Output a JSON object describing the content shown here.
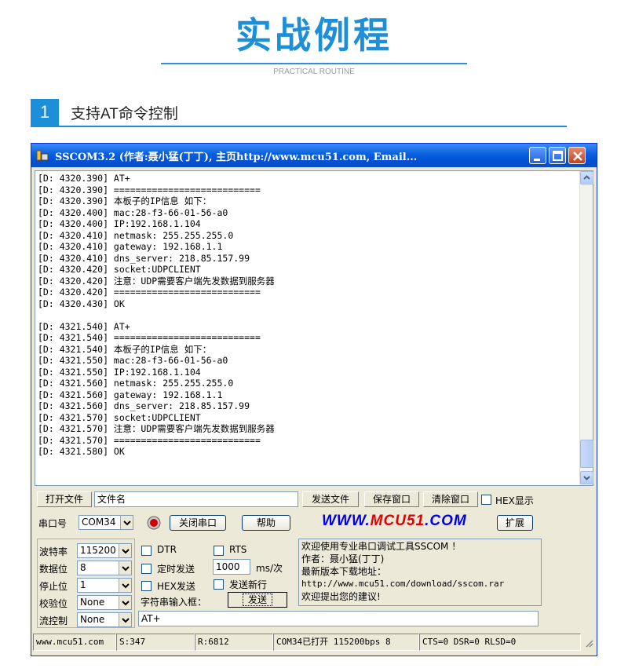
{
  "banner": {
    "title": "实战例程",
    "subtitle": "PRACTICAL ROUTINE",
    "section_number": "1",
    "section_title": "支持AT命令控制"
  },
  "window": {
    "title": "SSCOM3.2 (作者:聂小猛(丁丁), 主页http://www.mcu51.com,   Email...",
    "buttons": [
      "minimize",
      "maximize",
      "close"
    ]
  },
  "console_lines": [
    "[D: 4320.390] AT+",
    "[D: 4320.390] ===========================",
    "[D: 4320.390] 本板子的IP信息 如下：",
    "[D: 4320.400] mac:28-f3-66-01-56-a0",
    "[D: 4320.400] IP:192.168.1.104",
    "[D: 4320.410] netmask: 255.255.255.0",
    "[D: 4320.410] gateway: 192.168.1.1",
    "[D: 4320.410] dns_server: 218.85.157.99",
    "[D: 4320.420] socket:UDPCLIENT",
    "[D: 4320.420] 注意：UDP需要客户端先发数据到服务器",
    "[D: 4320.420] ===========================",
    "[D: 4320.430] OK",
    "",
    "[D: 4321.540] AT+",
    "[D: 4321.540] ===========================",
    "[D: 4321.540] 本板子的IP信息 如下：",
    "[D: 4321.550] mac:28-f3-66-01-56-a0",
    "[D: 4321.550] IP:192.168.1.104",
    "[D: 4321.560] netmask: 255.255.255.0",
    "[D: 4321.560] gateway: 192.168.1.1",
    "[D: 4321.560] dns_server: 218.85.157.99",
    "[D: 4321.570] socket:UDPCLIENT",
    "[D: 4321.570] 注意：UDP需要客户端先发数据到服务器",
    "[D: 4321.570] ===========================",
    "[D: 4321.580] OK"
  ],
  "toolbar": {
    "open_file": "打开文件",
    "file_name": "文件名",
    "send_file": "发送文件",
    "save_window": "保存窗口",
    "clear_window": "清除窗口",
    "hex_display": "HEX显示"
  },
  "port_row": {
    "port_label": "串口号",
    "port_value": "COM34",
    "close_port": "关闭串口",
    "help": "帮助",
    "logo_left": "WWW.",
    "logo_mid": "MCU51",
    "logo_right": ".COM",
    "expand": "扩展"
  },
  "settings": {
    "baud_label": "波特率",
    "baud_value": "115200",
    "data_bits_label": "数据位",
    "data_bits_value": "8",
    "stop_bits_label": "停止位",
    "stop_bits_value": "1",
    "parity_label": "校验位",
    "parity_value": "None",
    "flow_label": "流控制",
    "flow_value": "None"
  },
  "options": {
    "dtr": "DTR",
    "rts": "RTS",
    "timed_send": "定时发送",
    "interval_value": "1000",
    "interval_unit": "ms/次",
    "hex_send": "HEX发送",
    "send_newline": "发送新行",
    "input_label": "字符串输入框：",
    "send_button": "发送",
    "input_value": "AT+"
  },
  "info_box": {
    "line1": "欢迎使用专业串口调试工具SSCOM ！",
    "line2": "作者：聂小猛(丁丁)",
    "line3": "最新版本下载地址：",
    "line4": "http://www.mcu51.com/download/sscom.rar",
    "line5": "欢迎提出您的建议!"
  },
  "status": {
    "site": "www.mcu51.com",
    "sent": "S:347",
    "received": "R:6812",
    "port_state": "COM34已打开  115200bps  8",
    "lines": "CTS=0 DSR=0 RLSD=0"
  },
  "colors": {
    "accent": "#1d8fd8",
    "titlebar": "#0a5ee0",
    "logo_blue": "#0000e8",
    "logo_red": "#e00000"
  }
}
